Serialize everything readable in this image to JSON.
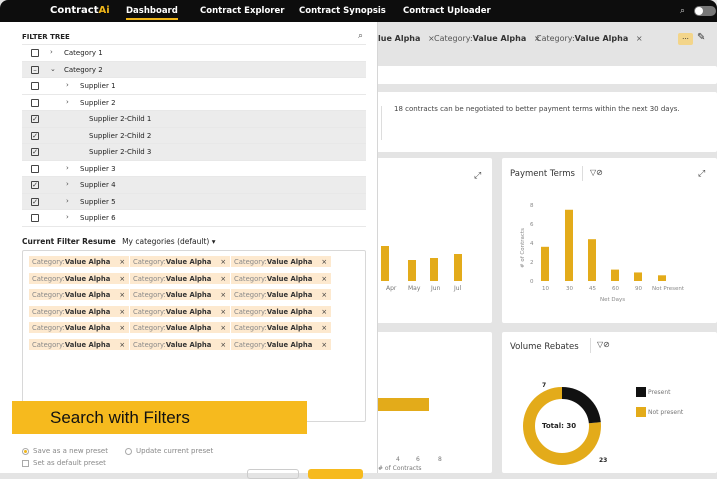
{
  "app": {
    "brand_prefix": "Contract",
    "brand_suffix": "Ai"
  },
  "nav": [
    "Dashboard",
    "Contract Explorer",
    "Contract Synopsis",
    "Contract Uploader"
  ],
  "background": {
    "chips": [
      {
        "key": "",
        "value": "lue Alpha"
      },
      {
        "key": "Category:",
        "value": "Value Alpha"
      },
      {
        "key": "Category:",
        "value": "Value Alpha"
      }
    ],
    "more_label": "...",
    "insight_text": "18 contracts can be negotiated to better payment terms within the next 30 days.",
    "months": [
      "Apr",
      "May",
      "Jun",
      "Jul"
    ],
    "payment_terms": {
      "title": "Payment Terms",
      "ylabel": "# of Contracts",
      "xlabel": "Net Days",
      "yticks": [
        "8",
        "6",
        "4",
        "2",
        "0"
      ],
      "categories": [
        "10",
        "30",
        "45",
        "60",
        "90",
        "Not Present"
      ],
      "values": [
        3.6,
        7.5,
        4.4,
        1.2,
        0.9,
        0.6
      ]
    },
    "volume_rebates": {
      "title": "Volume Rebates",
      "total_label": "Total: 30",
      "present_value": "7",
      "not_present_value": "23",
      "legend_present": "Present",
      "legend_not_present": "Not present"
    },
    "bar_axis": [
      "4",
      "6",
      "8"
    ],
    "bar_axis_label": "# of Contracts"
  },
  "panel": {
    "title": "FILTER TREE",
    "tree": [
      {
        "label": "Category 1",
        "checked": false,
        "level": 0,
        "chevron": ">",
        "shaded": false
      },
      {
        "label": "Category 2",
        "checked": "partial",
        "level": 0,
        "chevron": "v",
        "shaded": true
      },
      {
        "label": "Supplier 1",
        "checked": false,
        "level": 1,
        "chevron": ">",
        "shaded": false
      },
      {
        "label": "Supplier 2",
        "checked": false,
        "level": 1,
        "chevron": ">",
        "shaded": false
      },
      {
        "label": "Supplier 2-Child 1",
        "checked": true,
        "level": 2,
        "chevron": "",
        "shaded": true
      },
      {
        "label": "Supplier 2-Child 2",
        "checked": true,
        "level": 2,
        "chevron": "",
        "shaded": true
      },
      {
        "label": "Supplier 2-Child 3",
        "checked": true,
        "level": 2,
        "chevron": "",
        "shaded": true
      },
      {
        "label": "Supplier 3",
        "checked": false,
        "level": 1,
        "chevron": ">",
        "shaded": false
      },
      {
        "label": "Supplier 4",
        "checked": true,
        "level": 1,
        "chevron": ">",
        "shaded": true
      },
      {
        "label": "Supplier 5",
        "checked": true,
        "level": 1,
        "chevron": ">",
        "shaded": true
      },
      {
        "label": "Supplier 6",
        "checked": false,
        "level": 1,
        "chevron": ">",
        "shaded": false
      }
    ],
    "resume_label": "Current Filter Resume",
    "preset_name": "My categories (default)",
    "chip_key": "Category:",
    "chip_value": "Value Alpha",
    "chip_rows": 6,
    "chip_cols": 3,
    "callout": "Search with Filters",
    "save_new": "Save as a new preset",
    "update_current": "Update current preset",
    "set_default": "Set as default preset"
  },
  "colors": {
    "accent": "#f6ba1e",
    "chip_bg": "#fde9cf",
    "nav_bg": "#0d0d0d",
    "rebate_present": "#111111"
  }
}
